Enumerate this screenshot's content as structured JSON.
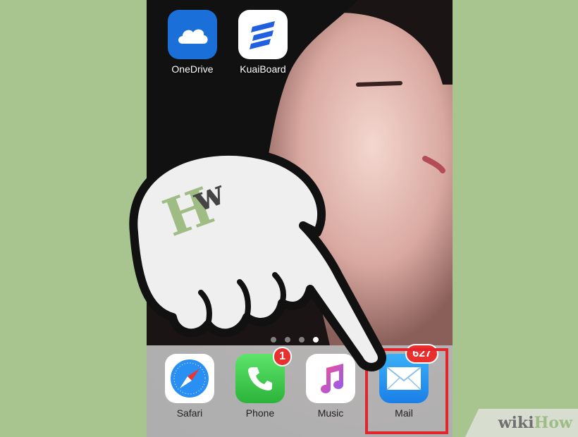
{
  "home_screen": {
    "apps": [
      {
        "label": "OneDrive",
        "color": "#1b6fd8"
      },
      {
        "label": "KuaiBoard",
        "color": "#ffffff"
      }
    ],
    "page_dots": 4,
    "active_page": 4
  },
  "dock": {
    "apps": [
      {
        "label": "Safari"
      },
      {
        "label": "Phone",
        "badge": "1"
      },
      {
        "label": "Music"
      },
      {
        "label": "Mail",
        "badge": "627"
      }
    ]
  },
  "highlight_color": "#e3242b",
  "watermark": {
    "wiki": "wiki",
    "how": "How"
  }
}
